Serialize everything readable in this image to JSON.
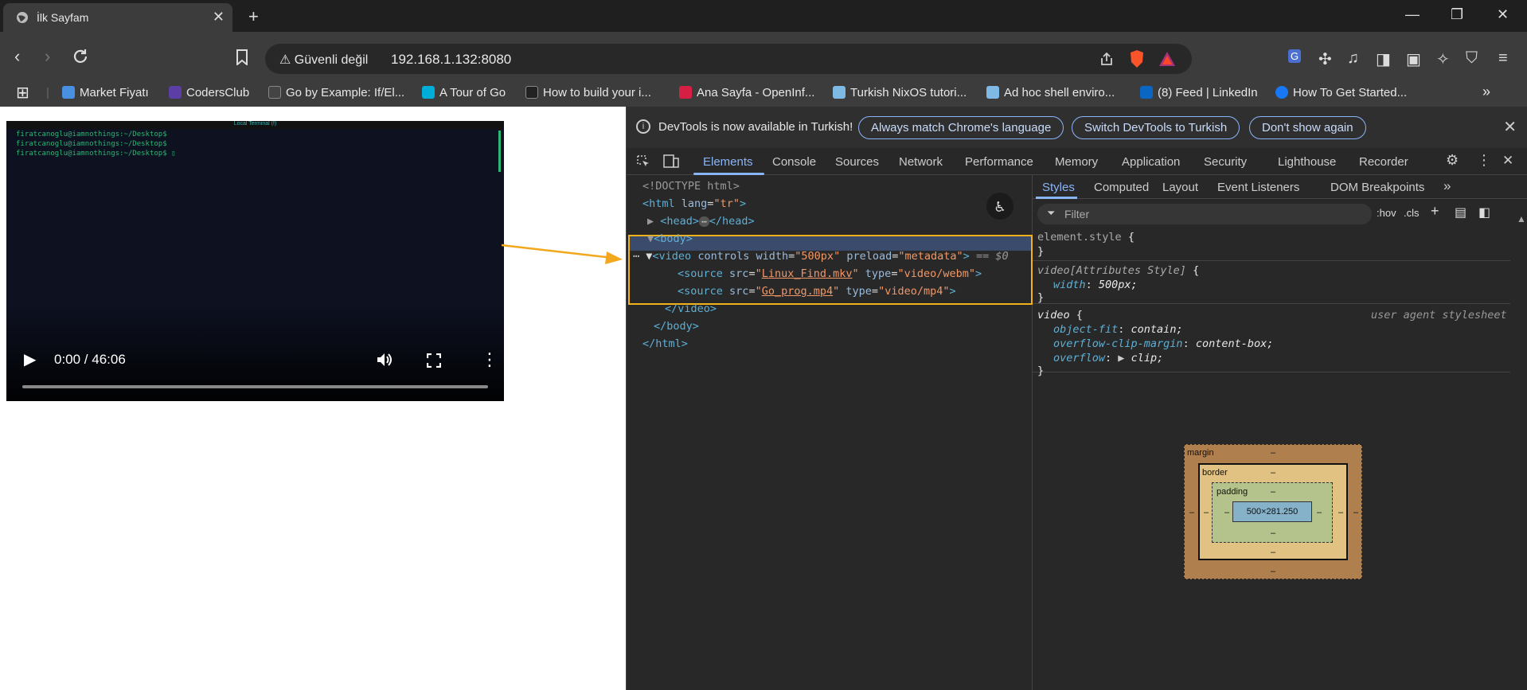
{
  "tab": {
    "title": "İlk Sayfam",
    "close": "✕",
    "new": "+"
  },
  "window": {
    "minimize": "—",
    "maximize": "❐",
    "close": "✕"
  },
  "toolbar": {
    "security": "Güvenli değil",
    "url": "192.168.1.132:8080"
  },
  "bookmarks": [
    {
      "label": "Market Fiyatı",
      "color": "#4a90e2"
    },
    {
      "label": "CodersClub",
      "color": "#5b3ea6"
    },
    {
      "label": "Go by Example: If/El...",
      "color": "#444"
    },
    {
      "label": "A Tour of Go",
      "color": "#00add8"
    },
    {
      "label": "How to build your i...",
      "color": "#222"
    },
    {
      "label": "Ana Sayfa - OpenInf...",
      "color": "#d61f45"
    },
    {
      "label": "Turkish NixOS tutori...",
      "color": "#7ebae4"
    },
    {
      "label": "Ad hoc shell enviro...",
      "color": "#7ebae4"
    },
    {
      "label": "(8) Feed | LinkedIn",
      "color": "#0a66c2"
    },
    {
      "label": "How To Get Started...",
      "color": "#1877f2"
    }
  ],
  "video": {
    "terminal_title": "Local Terminal (f)",
    "lines": [
      "firatcanoglu@iamnothings:~/Desktop$",
      "firatcanoglu@iamnothings:~/Desktop$",
      "firatcanoglu@iamnothings:~/Desktop$ ▯"
    ],
    "time": "0:00 / 46:06"
  },
  "devtools": {
    "info": {
      "message": "DevTools is now available in Turkish!",
      "btn_match": "Always match Chrome's language",
      "btn_switch": "Switch DevTools to Turkish",
      "btn_dont": "Don't show again"
    },
    "tabs": [
      "Elements",
      "Console",
      "Sources",
      "Network",
      "Performance",
      "Memory",
      "Application",
      "Security",
      "Lighthouse",
      "Recorder"
    ],
    "dom": {
      "doctype": "<!DOCTYPE html>",
      "html_open": "<html",
      "lang_attr": "lang",
      "lang_val": "\"tr\"",
      "head": "<head>",
      "head_close": "</head>",
      "ellipsis": "⋯",
      "body_open": "<body>",
      "video_open": "<video",
      "controls_attr": "controls",
      "width_attr": "width",
      "width_val": "\"500px\"",
      "preload_attr": "preload",
      "preload_val": "\"metadata\"",
      "selected_marker": "== $0",
      "source_tag": "<source",
      "src_attr": "src",
      "type_attr": "type",
      "src1": "Linux_Find.mkv",
      "type1": "\"video/webm\"",
      "src2": "Go_prog.mp4",
      "type2": "\"video/mp4\"",
      "video_close": "</video>",
      "body_close": "</body>",
      "html_close": "</html>"
    },
    "styles": {
      "subtabs": [
        "Styles",
        "Computed",
        "Layout",
        "Event Listeners",
        "DOM Breakpoints"
      ],
      "filter_placeholder": "Filter",
      "hov": ":hov",
      "cls": ".cls",
      "rule1_selector": "element.style",
      "rule2_selector": "video[Attributes Style]",
      "rule2_prop": "width",
      "rule2_val": "500px;",
      "rule3_selector": "video",
      "rule3_origin": "user agent stylesheet",
      "rule3_props": [
        {
          "name": "object-fit",
          "value": "contain;"
        },
        {
          "name": "overflow-clip-margin",
          "value": "content-box;"
        },
        {
          "name": "overflow",
          "value": "clip;"
        }
      ]
    },
    "box_model": {
      "margin": "margin",
      "border": "border",
      "padding": "padding",
      "content": "500×281.250",
      "dash": "–"
    }
  }
}
